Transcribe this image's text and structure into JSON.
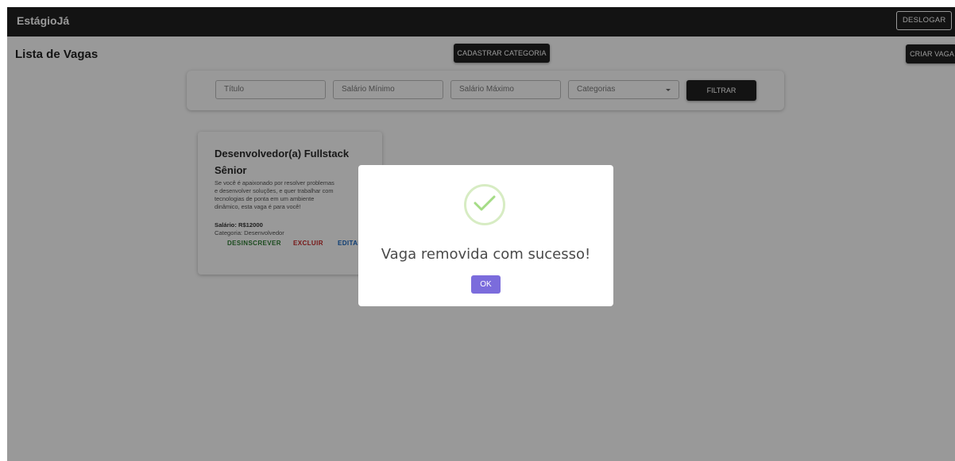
{
  "app": {
    "brand": "EstágioJá",
    "logout_label": "DESLOGAR"
  },
  "page": {
    "title": "Lista de Vagas",
    "create_category_label": "CADASTRAR CATEGORIA",
    "create_job_label": "CRIAR VAGA"
  },
  "filters": {
    "title_placeholder": "Título",
    "min_salary_placeholder": "Salário Mínimo",
    "max_salary_placeholder": "Salário Máximo",
    "category_placeholder": "Categorias",
    "filter_label": "FILTRAR"
  },
  "jobs": [
    {
      "title": "Desenvolvedor(a) Fullstack Sênior",
      "description": "Se você é apaixonado por resolver problemas\ne desenvolver soluções, e quer trabalhar com\ntecnologias de ponta em um ambiente\ndinâmico, esta vaga é para você!",
      "salary": "Salário: R$12000",
      "category": "Categoria: Desenvolvedor",
      "actions": {
        "unsubscribe": "DESINSCREVER",
        "delete": "EXCLUIR",
        "edit": "EDITAR"
      }
    }
  ],
  "modal": {
    "icon": "success-check-icon",
    "message": "Vaga removida com sucesso!",
    "ok_label": "OK",
    "accent_color": "#7b6cdc",
    "check_color": "#a5dc86"
  }
}
